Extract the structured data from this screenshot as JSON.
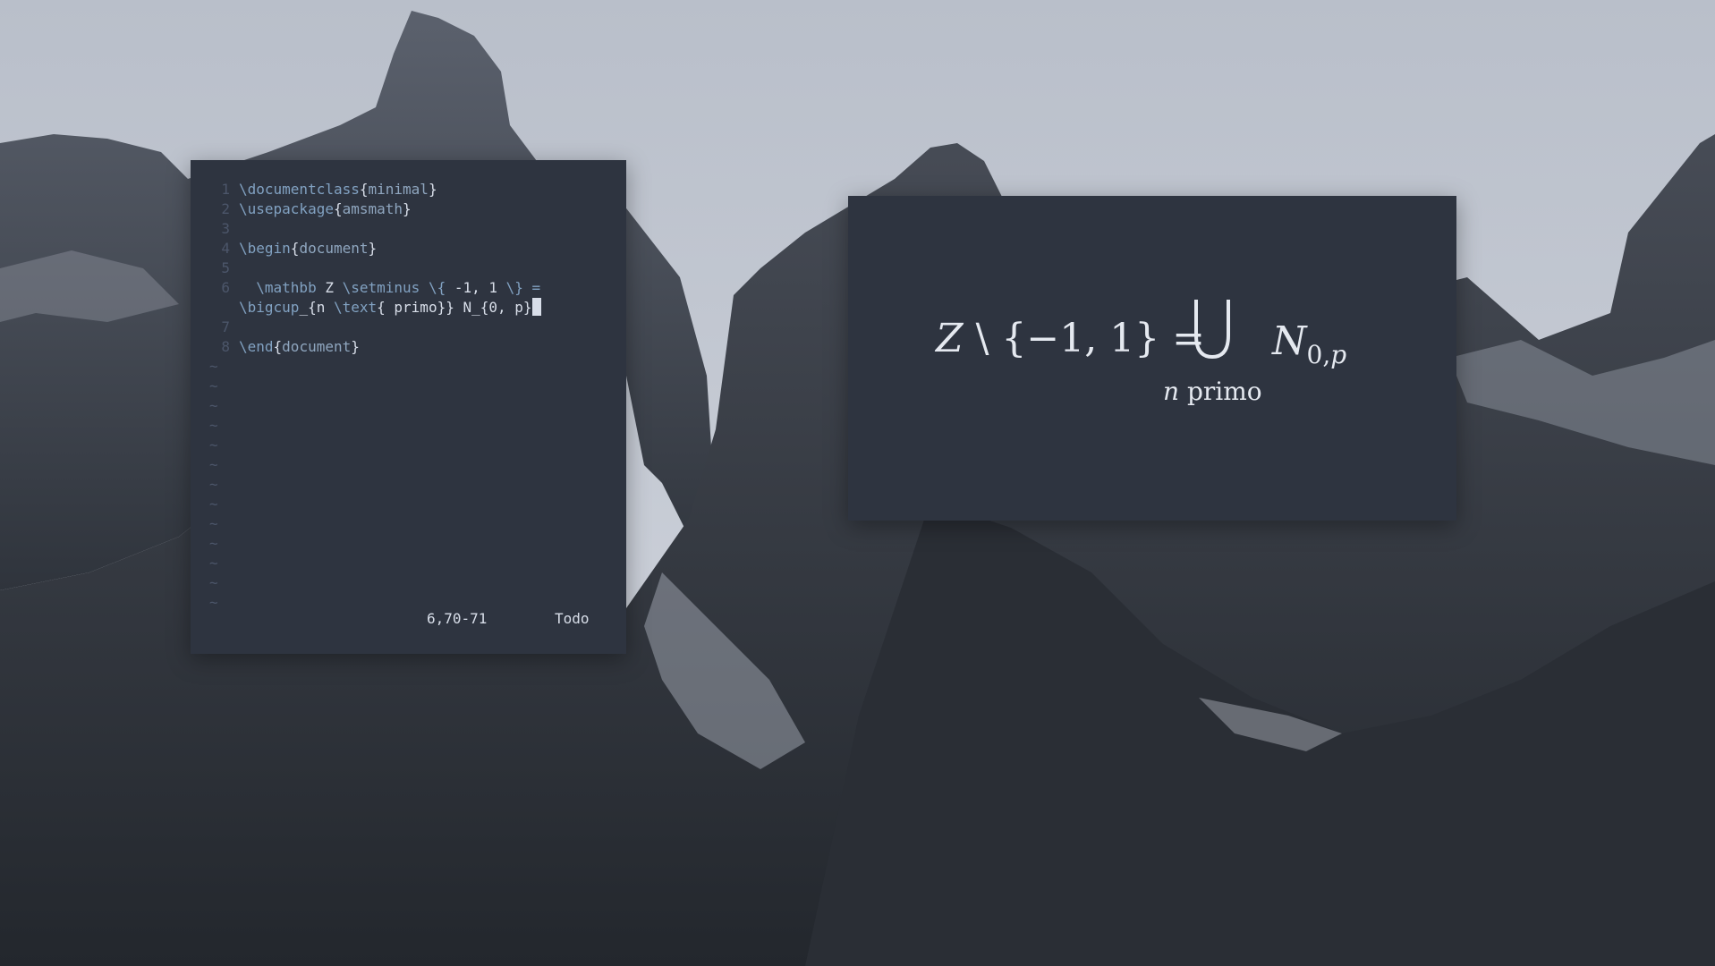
{
  "editor": {
    "lines": [
      {
        "number": "1",
        "segments": [
          {
            "t": "\\documentclass",
            "c": "kw"
          },
          {
            "t": "{",
            "c": "br"
          },
          {
            "t": "minimal",
            "c": "arg"
          },
          {
            "t": "}",
            "c": "br"
          }
        ]
      },
      {
        "number": "2",
        "segments": [
          {
            "t": "\\usepackage",
            "c": "kw"
          },
          {
            "t": "{",
            "c": "br"
          },
          {
            "t": "amsmath",
            "c": "arg"
          },
          {
            "t": "}",
            "c": "br"
          }
        ]
      },
      {
        "number": "3",
        "segments": []
      },
      {
        "number": "4",
        "segments": [
          {
            "t": "\\begin",
            "c": "kw"
          },
          {
            "t": "{",
            "c": "br"
          },
          {
            "t": "document",
            "c": "arg"
          },
          {
            "t": "}",
            "c": "br"
          }
        ]
      },
      {
        "number": "5",
        "segments": []
      },
      {
        "number": "6",
        "segments": [
          {
            "t": "  ",
            "c": "plain"
          },
          {
            "t": "\\mathbb",
            "c": "kw"
          },
          {
            "t": " Z ",
            "c": "plain"
          },
          {
            "t": "\\setminus",
            "c": "kw"
          },
          {
            "t": " ",
            "c": "plain"
          },
          {
            "t": "\\{",
            "c": "kw"
          },
          {
            "t": " -1, 1 ",
            "c": "plain"
          },
          {
            "t": "\\}",
            "c": "kw"
          },
          {
            "t": " =",
            "c": "kw"
          }
        ]
      },
      {
        "number": "",
        "segments": [
          {
            "t": "\\bigcup",
            "c": "kw"
          },
          {
            "t": "_{n ",
            "c": "plain"
          },
          {
            "t": "\\text",
            "c": "kw"
          },
          {
            "t": "{ primo}} N_{0, p}",
            "c": "plain"
          }
        ],
        "cursor": true
      },
      {
        "number": "7",
        "segments": []
      },
      {
        "number": "8",
        "segments": [
          {
            "t": "\\end",
            "c": "kw"
          },
          {
            "t": "{",
            "c": "br"
          },
          {
            "t": "document",
            "c": "arg"
          },
          {
            "t": "}",
            "c": "br"
          }
        ]
      }
    ],
    "tilde_char": "~",
    "tilde_count": 13,
    "status": {
      "position": "6,70-71",
      "scroll": "Todo"
    }
  },
  "preview": {
    "lhs_var": "Z",
    "lhs_rest": " \\ {−1, 1} = ",
    "bigcup_symbol": "⋃",
    "subscript_var": "n",
    "subscript_text": " primo",
    "rhs_var": "N",
    "rhs_sub_num": "0,",
    "rhs_sub_var": "p"
  },
  "colors": {
    "window_bg": "#2e3440",
    "keyword": "#81a1c1",
    "text": "#d8dee9",
    "line_number": "#4c566a"
  }
}
